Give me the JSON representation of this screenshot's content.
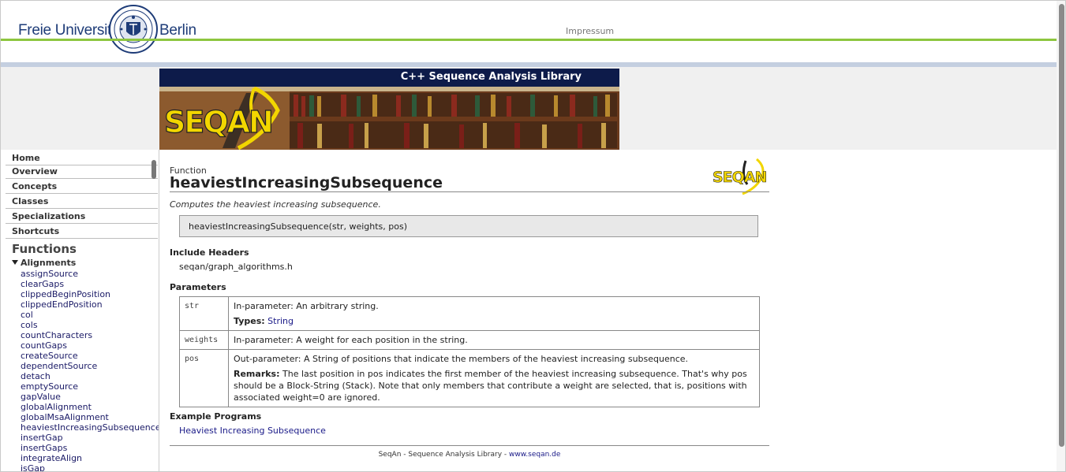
{
  "header": {
    "brand_left": "Freie Universität",
    "brand_right": "Berlin",
    "impressum": "Impressum"
  },
  "banner": {
    "title": "C++ Sequence Analysis Library",
    "logo_text": "SEQAN"
  },
  "sidebar": {
    "nav": [
      "Home",
      "Overview",
      "Concepts",
      "Classes",
      "Specializations",
      "Shortcuts"
    ],
    "functions_heading": "Functions",
    "group": "Alignments",
    "items": [
      "assignSource",
      "clearGaps",
      "clippedBeginPosition",
      "clippedEndPosition",
      "col",
      "cols",
      "countCharacters",
      "countGaps",
      "createSource",
      "dependentSource",
      "detach",
      "emptySource",
      "gapValue",
      "globalAlignment",
      "globalMsaAlignment",
      "heaviestIncreasingSubsequence",
      "insertGap",
      "insertGaps",
      "integrateAlign",
      "isGap"
    ]
  },
  "main": {
    "kind": "Function",
    "name": "heaviestIncreasingSubsequence",
    "summary": "Computes the heaviest increasing subsequence.",
    "signature": "heaviestIncreasingSubsequence(str, weights, pos)",
    "include_heading": "Include Headers",
    "include": "seqan/graph_algorithms.h",
    "params_heading": "Parameters",
    "params": [
      {
        "name": "str",
        "desc": "In-parameter: An arbitrary string.",
        "types_label": "Types:",
        "types_value": "String"
      },
      {
        "name": "weights",
        "desc": "In-parameter: A weight for each position in the string."
      },
      {
        "name": "pos",
        "desc": "Out-parameter: A String of positions that indicate the members of the heaviest increasing subsequence.",
        "remarks_label": "Remarks:",
        "remarks_value": "The last position in pos indicates the first member of the heaviest increasing subsequence. That's why pos should be a Block-String (Stack). Note that only members that contribute a weight are selected, that is, positions with associated weight=0 are ignored."
      }
    ],
    "examples_heading": "Example Programs",
    "example_link": "Heaviest Increasing Subsequence",
    "logo_text": "SEQAN"
  },
  "footer": {
    "text": "SeqAn - Sequence Analysis Library - ",
    "link": "www.seqan.de"
  },
  "colors": {
    "fu_blue": "#1e3c78",
    "fu_green": "#8dc63f",
    "banner_navy": "#0d1b4a",
    "link": "#1a1a88",
    "seqan_yellow": "#f2d600"
  }
}
